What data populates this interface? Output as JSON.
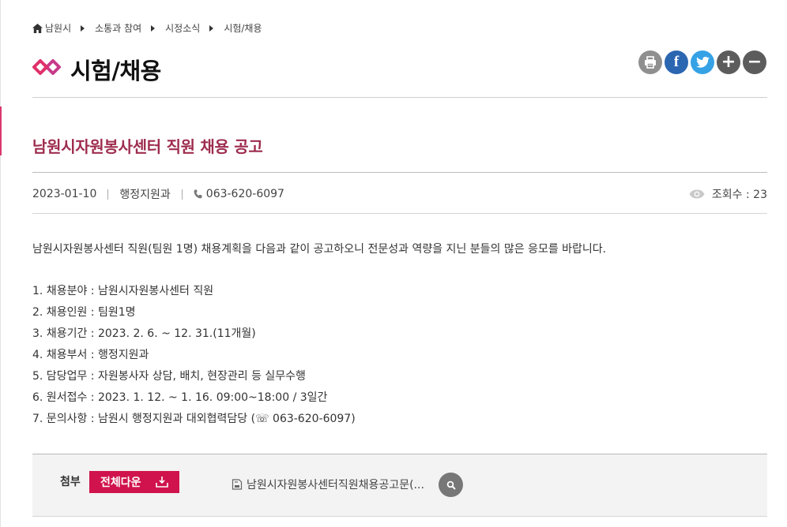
{
  "breadcrumb": [
    "남원시",
    "소통과 참여",
    "시정소식",
    "시험/채용"
  ],
  "page_title": "시험/채용",
  "share": {
    "facebook_glyph": "f",
    "plus_glyph": "+",
    "minus_glyph": "−",
    "icons": [
      "print-icon",
      "facebook-icon",
      "twitter-icon",
      "zoom-in-icon",
      "zoom-out-icon"
    ]
  },
  "article": {
    "title": "남원시자원봉사센터 직원 채용 공고",
    "date": "2023-01-10",
    "department": "행정지원과",
    "phone": "063-620-6097",
    "views": "조회수 : 23",
    "intro": "남원시자원봉사센터 직원(팀원 1명) 채용계획을 다음과 같이 공고하오니 전문성과 역량을 지닌 분들의 많은 응모를 바랍니다.",
    "items": [
      "1. 채용분야 : 남원시자원봉사센터 직원",
      "2. 채용인원 : 팀원1명",
      "3. 채용기간 : 2023. 2. 6. ~ 12. 31.(11개월)",
      "4. 채용부서 : 행정지원과",
      "5. 담당업무 : 자원봉사자 상담, 배치, 현장관리 등 실무수행",
      "6. 원서접수 : 2023. 1. 12. ~ 1. 16. 09:00~18:00 / 3일간",
      "7. 문의사항 : 남원시 행정지원과 대외협력담당 (☏ 063-620-6097)"
    ]
  },
  "attachments": {
    "label": "첨부",
    "download_all": "전체다운",
    "file_name": "남원시자원봉사센터직원채용공고문(..."
  },
  "colors": {
    "accent": "#d0134c",
    "title": "#9e2d4e",
    "facebook": "#2b66b1",
    "twitter": "#36a2e6"
  }
}
